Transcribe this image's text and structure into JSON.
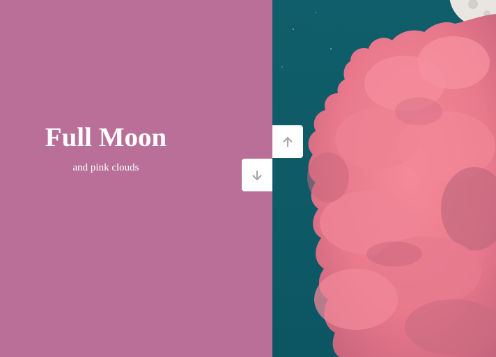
{
  "slide": {
    "title": "Full Moon",
    "subtitle": "and pink clouds"
  },
  "navigation": {
    "up_icon": "arrow-up-icon",
    "down_icon": "arrow-down-icon"
  },
  "colors": {
    "panel_background": "#b96f98",
    "sky": "#0f5f6c",
    "clouds": "#f07f92",
    "cloud_shadow": "#c86478",
    "moon": "#e9e6e2",
    "button_background": "#ffffff",
    "button_icon": "#a9a9a9"
  }
}
